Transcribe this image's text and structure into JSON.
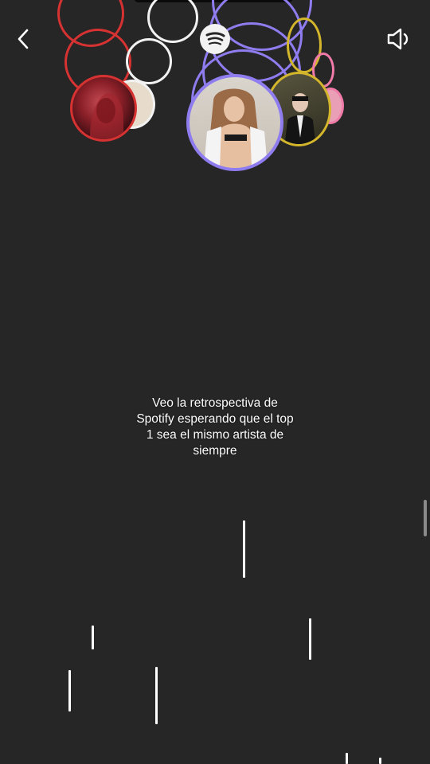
{
  "header": {
    "back_icon": "chevron-left-icon",
    "sound_icon": "speaker-icon",
    "brand_icon": "spotify-icon"
  },
  "caption": {
    "lines": [
      "Veo la retrospectiva de",
      "Spotify esperando que el top",
      "1 sea el mismo artista de",
      "siempre"
    ]
  },
  "colors": {
    "background": "#262626",
    "red": "#d63232",
    "white": "#f2f2f2",
    "purple": "#8f7df0",
    "yellow": "#d4b62c",
    "pink": "#f07aa8"
  }
}
